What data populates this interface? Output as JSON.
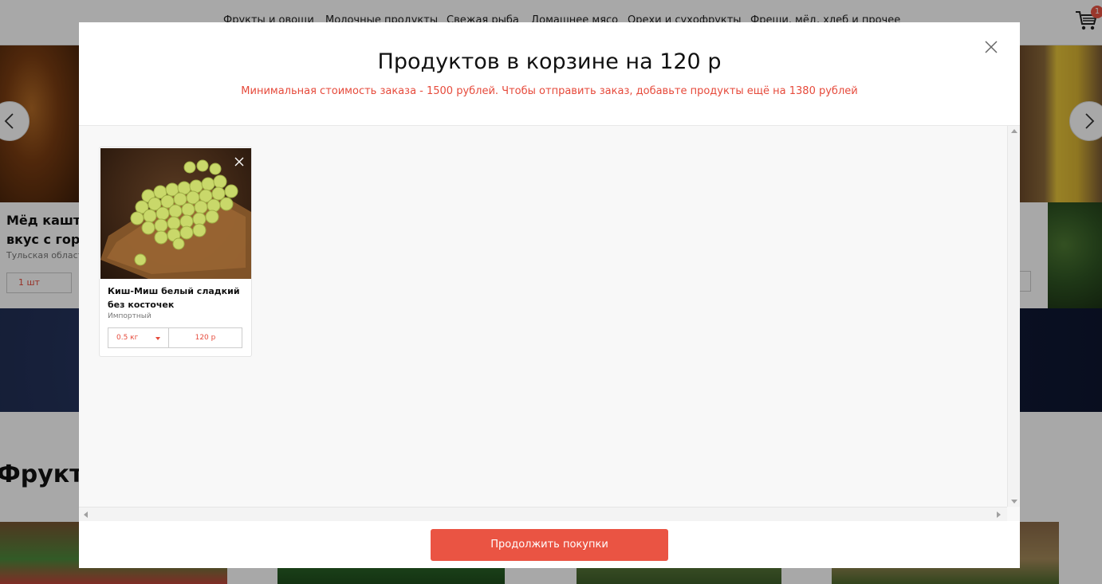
{
  "nav": {
    "items": [
      "Фрукты и овощи",
      "Молочные продукты",
      "Свежая рыба",
      "Домашнее мясо",
      "Орехи и сухофрукты",
      "Фреши, мёд, хлеб и прочее"
    ],
    "cart_count": "1"
  },
  "background": {
    "featured_title_line1": "Мёд каштан",
    "featured_title_line2": "вкус с горч",
    "featured_region": "Тульская област",
    "featured_qty": "1 шт",
    "section_title": "Фрукты"
  },
  "modal": {
    "title": "Продуктов в корзине на 120 р",
    "warning": "Минимальная стоимость заказа - 1500 рублей. Чтобы отправить заказ, добавьте продукты ещё на 1380 рублей",
    "items": [
      {
        "name": "Киш-Миш белый сладкий без косточек",
        "origin": "Импортный",
        "quantity": "0.5 кг",
        "price": "120 р"
      }
    ],
    "continue_label": "Продолжить покупки"
  },
  "colors": {
    "accent": "#ea5443",
    "warning_text": "#e64a3b"
  }
}
